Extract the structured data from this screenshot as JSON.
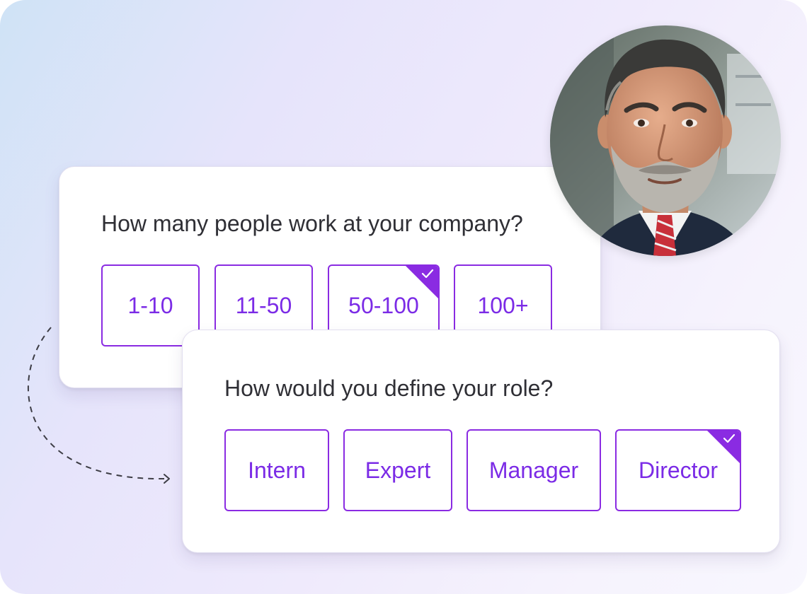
{
  "company_question": {
    "prompt": "How many people work at your company?",
    "options": [
      "1-10",
      "11-50",
      "50-100",
      "100+"
    ],
    "selected": "50-100"
  },
  "role_question": {
    "prompt": "How would you define your role?",
    "options": [
      "Intern",
      "Expert",
      "Manager",
      "Director"
    ],
    "selected": "Director"
  },
  "colors": {
    "accent": "#8a2be2",
    "option_text": "#7b2be6",
    "question_text": "#2f2f35",
    "card_bg": "#ffffff"
  },
  "icons": {
    "selected_check": "check-icon",
    "flow_arrow": "dashed-arrow-icon"
  }
}
